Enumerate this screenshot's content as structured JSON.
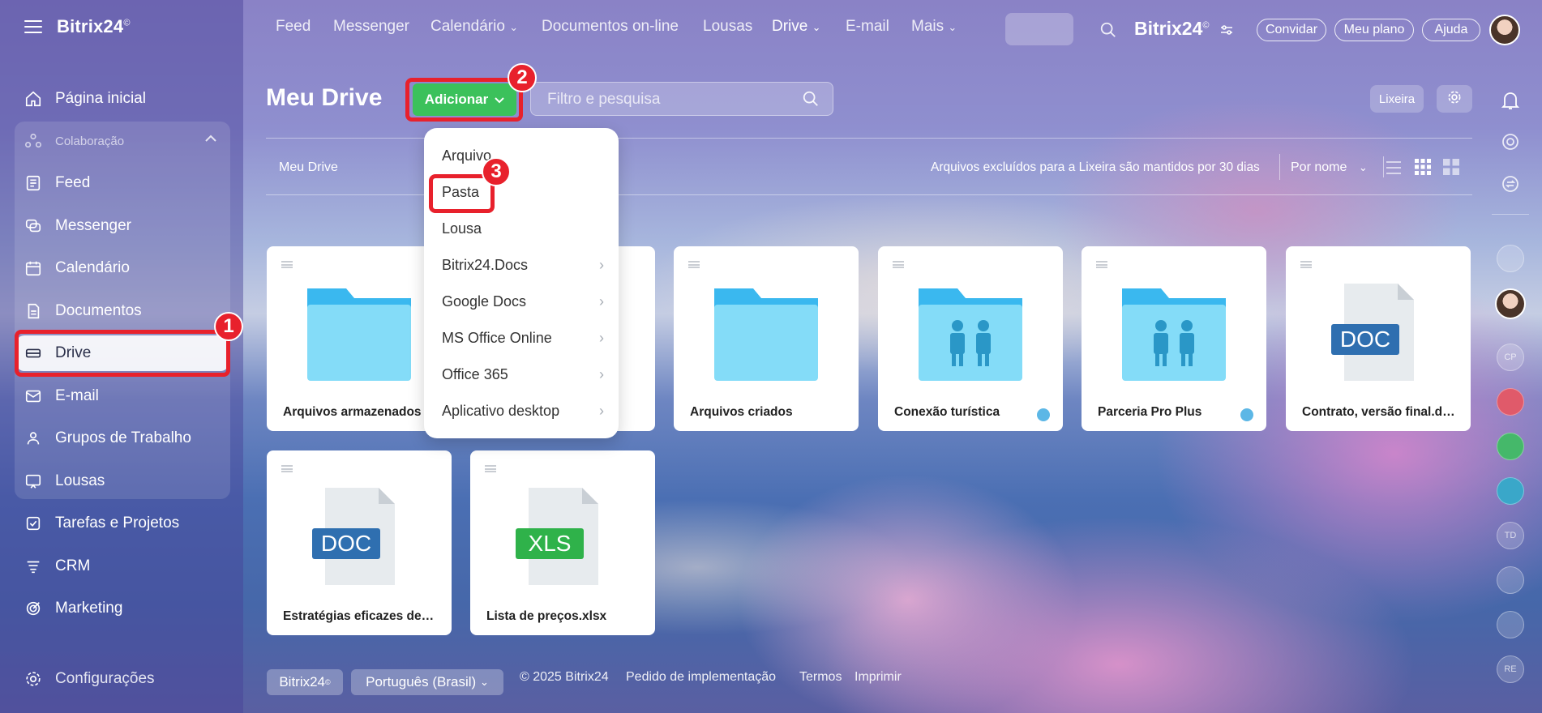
{
  "brand": {
    "name": "Bitrix24",
    "mark": "©"
  },
  "sidebar": {
    "home": "Página inicial",
    "group_label": "Colaboração",
    "items": [
      {
        "label": "Feed",
        "icon": "feed-icon"
      },
      {
        "label": "Messenger",
        "icon": "messenger-icon"
      },
      {
        "label": "Calendário",
        "icon": "calendar-icon"
      },
      {
        "label": "Documentos",
        "icon": "documents-icon"
      },
      {
        "label": "Drive",
        "icon": "drive-icon"
      },
      {
        "label": "E-mail",
        "icon": "mail-icon"
      },
      {
        "label": "Grupos de Trabalho",
        "icon": "groups-icon"
      },
      {
        "label": "Lousas",
        "icon": "boards-icon"
      }
    ],
    "lower_items": [
      {
        "label": "Tarefas e Projetos",
        "icon": "tasks-icon"
      },
      {
        "label": "CRM",
        "icon": "crm-icon"
      },
      {
        "label": "Marketing",
        "icon": "marketing-icon"
      }
    ],
    "settings": "Configurações"
  },
  "topnav": {
    "links": [
      "Feed",
      "Messenger",
      "Calendário",
      "Documentos on-line",
      "Lousas",
      "Drive",
      "E-mail",
      "Mais"
    ],
    "brand": "Bitrix24",
    "invite": "Convidar",
    "plan": "Meu plano",
    "help": "Ajuda"
  },
  "main": {
    "title": "Meu Drive",
    "add_label": "Adicionar",
    "search_placeholder": "Filtro e pesquisa",
    "trash_label": "Lixeira",
    "breadcrumb": "Meu Drive",
    "notice": "Arquivos excluídos para a Lixeira são mantidos por 30 dias",
    "sort_label": "Por nome"
  },
  "dropdown": {
    "items": [
      {
        "label": "Arquivo",
        "submenu": false
      },
      {
        "label": "Pasta",
        "submenu": false
      },
      {
        "label": "Lousa",
        "submenu": false
      },
      {
        "label": "Bitrix24.Docs",
        "submenu": true
      },
      {
        "label": "Google Docs",
        "submenu": true
      },
      {
        "label": "MS Office Online",
        "submenu": true
      },
      {
        "label": "Office 365",
        "submenu": true
      },
      {
        "label": "Aplicativo desktop",
        "submenu": true
      }
    ]
  },
  "files": [
    {
      "name": "Arquivos armazenados",
      "type": "folder",
      "shared": false
    },
    {
      "name": "",
      "type": "folder",
      "shared": false
    },
    {
      "name": "Arquivos criados",
      "type": "folder",
      "shared": false
    },
    {
      "name": "Conexão turística",
      "type": "shared-folder",
      "shared": true
    },
    {
      "name": "Parceria Pro Plus",
      "type": "shared-folder",
      "shared": true
    },
    {
      "name": "Contrato, versão final.docx",
      "type": "doc",
      "ext": "DOC",
      "shared": false
    },
    {
      "name": "Estratégias eficazes de ma...",
      "type": "doc",
      "ext": "DOC",
      "shared": false
    },
    {
      "name": "Lista de preços.xlsx",
      "type": "xls",
      "ext": "XLS",
      "shared": false
    }
  ],
  "annotations": [
    "1",
    "2",
    "3"
  ],
  "footer": {
    "brand": "Bitrix24",
    "language": "Português (Brasil)",
    "copyright": "© 2025 Bitrix24",
    "implementation": "Pedido de implementação",
    "terms": "Termos",
    "print": "Imprimir"
  },
  "rail": [
    "CP",
    "TD",
    "RE"
  ],
  "colors": {
    "accent_green": "#3bc15b",
    "highlight_red": "#e8212c",
    "doc_blue": "#2f6fb0",
    "xls_green": "#2fb24a",
    "folder_blue": "#4cc4f0"
  }
}
